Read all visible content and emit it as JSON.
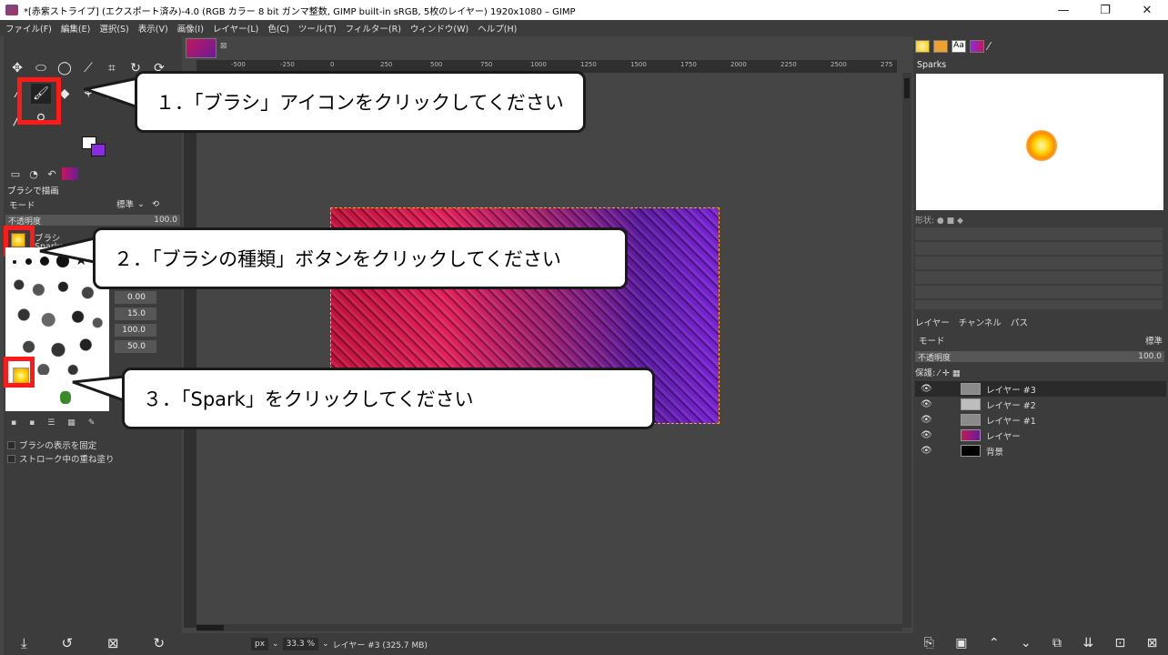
{
  "titlebar": {
    "title": "*[赤紫ストライプ] (エクスポート済み)-4.0 (RGB カラー 8 bit ガンマ整数, GIMP built-in sRGB, 5枚のレイヤー) 1920x1080 – GIMP",
    "minimize": "—",
    "maximize": "❐",
    "close": "✕"
  },
  "menu": [
    "ファイル(F)",
    "編集(E)",
    "選択(S)",
    "表示(V)",
    "画像(I)",
    "レイヤー(L)",
    "色(C)",
    "ツール(T)",
    "フィルター(R)",
    "ウィンドウ(W)",
    "ヘルプ(H)"
  ],
  "toolbox": {
    "options_title": "ブラシで描画",
    "mode_label": "モード",
    "mode_value": "標準",
    "opacity_label": "不透明度",
    "opacity_value": "100.0",
    "brush_label": "ブラシ",
    "brush_name": "Sparks",
    "fields": [
      "0.00",
      "15.0",
      "100.0",
      "50.0"
    ],
    "checkboxes": [
      "ブラシの表示を固定",
      "ストローク中の重ね塗り"
    ]
  },
  "canvas": {
    "ruler_ticks": [
      "-500",
      "-250",
      "0",
      "250",
      "500",
      "750",
      "1000",
      "1250",
      "1500",
      "1750",
      "2000",
      "2250",
      "2500",
      "275"
    ],
    "status_unit": "px",
    "zoom": "33.3 %",
    "status_text": "レイヤー #3 (325.7 MB)"
  },
  "rightdock": {
    "brush_preview_title": "Sparks",
    "shape_label": "形状:",
    "tabs": [
      "レイヤー",
      "チャンネル",
      "パス"
    ],
    "mode_label": "モード",
    "mode_value": "標準",
    "opacity_label": "不透明度",
    "opacity_value": "100.0",
    "lock_label": "保護:",
    "layers": [
      {
        "name": "レイヤー #3",
        "thumb": "#8a8a8a",
        "selected": true
      },
      {
        "name": "レイヤー #2",
        "thumb": "#bdbdbd",
        "selected": false
      },
      {
        "name": "レイヤー #1",
        "thumb": "#8a8a8a",
        "selected": false
      },
      {
        "name": "レイヤー",
        "thumb": "#c2185b",
        "selected": false
      },
      {
        "name": "背景",
        "thumb": "#000000",
        "selected": false
      }
    ]
  },
  "callouts": {
    "c1": "１．「ブラシ」アイコンをクリックしてください",
    "c2": "２．「ブラシの種類」ボタンをクリックしてください",
    "c3": "３．「Spark」をクリックしてください"
  },
  "colors": {
    "highlight": "#ff1a1a",
    "fg": "#ffffff",
    "bg": "#8a2be2"
  }
}
